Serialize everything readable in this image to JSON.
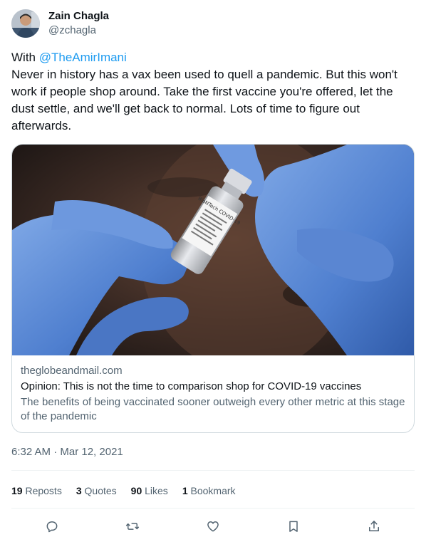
{
  "author": {
    "display_name": "Zain Chagla",
    "handle": "@zchagla"
  },
  "tweet": {
    "prefix": "With ",
    "mention": "@TheAmirImani",
    "body": "Never in history has a vax been used to quell a pandemic.  But this won't work if people shop around.  Take the first vaccine you're offered, let the dust settle, and we'll get back to normal.  Lots of time to figure out afterwards."
  },
  "card": {
    "image_alt": "Gloved hands holding a BioNTech COVID-19 vaccine vial",
    "vial_label": "BioNTech COVID-19",
    "domain": "theglobeandmail.com",
    "title": "Opinion: This is not the time to comparison shop for COVID-19 vaccines",
    "description": "The benefits of being vaccinated sooner outweigh every other metric at this stage of the pandemic"
  },
  "timestamp": "6:32 AM · Mar 12, 2021",
  "stats": {
    "reposts_count": "19",
    "reposts_label": " Reposts",
    "quotes_count": "3",
    "quotes_label": " Quotes",
    "likes_count": "90",
    "likes_label": " Likes",
    "bookmarks_count": "1",
    "bookmarks_label": " Bookmark"
  },
  "icons": {
    "reply": "reply-icon",
    "repost": "repost-icon",
    "like": "like-icon",
    "bookmark": "bookmark-icon",
    "share": "share-icon"
  },
  "colors": {
    "link": "#1d9bf0",
    "secondary_text": "#536471",
    "primary_text": "#0f1419",
    "border": "#cfd9de"
  }
}
